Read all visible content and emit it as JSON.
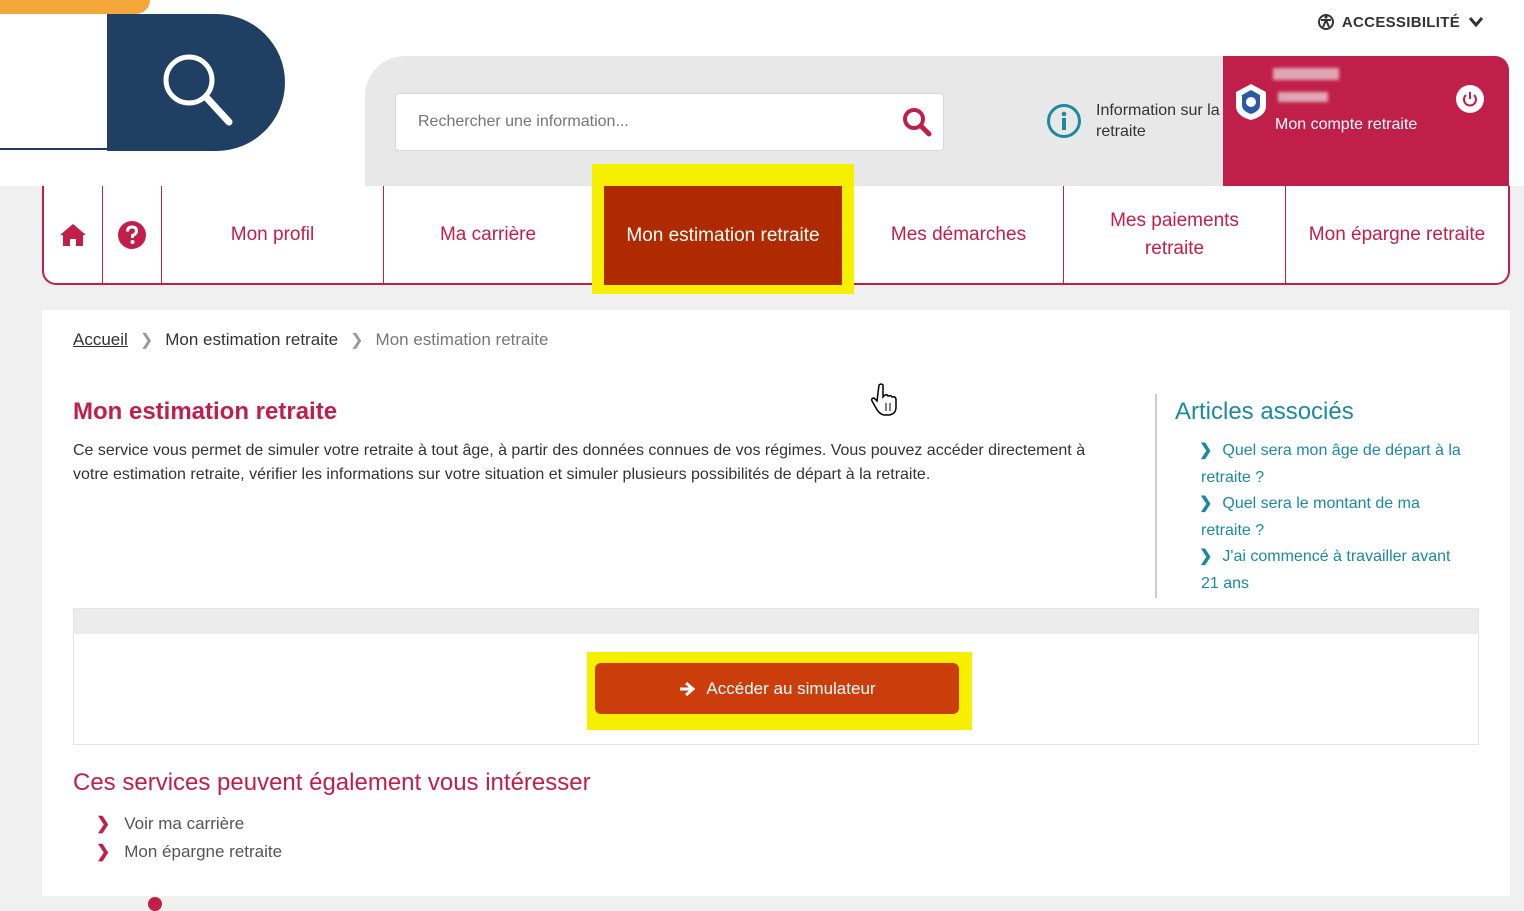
{
  "header": {
    "accessibility_label": "ACCESSIBILITÉ",
    "search_placeholder": "Rechercher une information...",
    "info_label": "Information sur la retraite",
    "account_label": "Mon compte retraite"
  },
  "nav": {
    "items": [
      {
        "label": "Mon profil"
      },
      {
        "label": "Ma carrière"
      },
      {
        "label": "Mon estimation retraite"
      },
      {
        "label": "Mes démarches"
      },
      {
        "label": "Mes paiements retraite"
      },
      {
        "label": "Mon épargne retraite"
      }
    ]
  },
  "breadcrumb": [
    "Accueil",
    "Mon estimation retraite",
    "Mon estimation retraite"
  ],
  "main": {
    "title": "Mon estimation retraite",
    "description": "Ce service vous permet de simuler votre retraite à tout âge, à partir des données connues de vos régimes. Vous pouvez accéder directement à votre estimation retraite, vérifier les informations sur votre situation et simuler plusieurs possibilités de départ à la retraite.",
    "simulator_button": "Accéder au simulateur"
  },
  "aside": {
    "title": "Articles associés",
    "links": [
      "Quel sera mon âge de départ à la retraite ?",
      "Quel sera le montant de ma retraite ?",
      "J'ai commencé à travailler avant 21 ans"
    ]
  },
  "services": {
    "title": "Ces services peuvent également vous intéresser",
    "items": [
      "Voir ma carrière",
      "Mon épargne retraite"
    ]
  },
  "colors": {
    "brand_red": "#c01f4a",
    "active_nav": "#b02a00",
    "button": "#cb3d0a",
    "highlight": "#f6f000",
    "link_teal": "#1a8aa0",
    "navy": "#1f3f63"
  }
}
